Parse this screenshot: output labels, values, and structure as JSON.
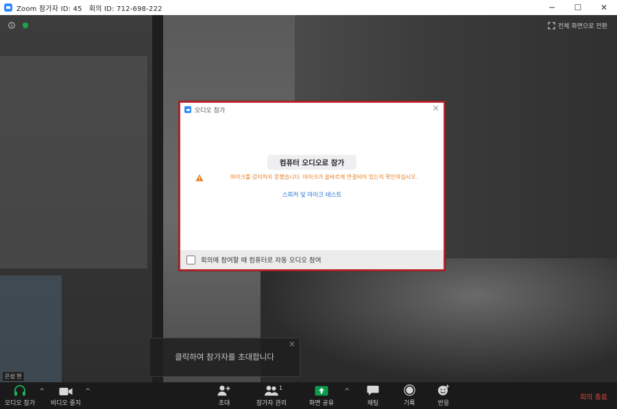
{
  "window": {
    "title": "Zoom 참가자 ID: 45   회의 ID: 712-698-222",
    "minimize_glyph": "─",
    "maximize_glyph": "☐",
    "close_glyph": "✕"
  },
  "video_overlay": {
    "fullscreen_label": "전체 화면으로 전환",
    "participant_name": "은성 한"
  },
  "dialog": {
    "title": "오디오 참가",
    "close_glyph": "×",
    "join_button_label": "컴퓨터 오디오로 참가",
    "warning_text": "마이크를 감지하지 못했습니다. 마이크가 올바르게 연결되어 있는지 확인하십시오.",
    "test_link_label": "스피커 및 마이크 테스트",
    "auto_join_label": "회의에 참여할 때 컴퓨터로 자동 오디오 참여",
    "auto_join_checked": false,
    "highlight_color": "#c0272d"
  },
  "invite_tooltip": {
    "text": "클릭하여 참가자를 초대합니다",
    "close_glyph": "×"
  },
  "toolbar": {
    "audio_label": "오디오 참가",
    "video_label": "비디오 중지",
    "invite_label": "초대",
    "participants_label": "참가자 관리",
    "participants_count": "1",
    "share_label": "화면 공유",
    "chat_label": "채팅",
    "record_label": "기록",
    "reactions_label": "반응",
    "end_label": "회의 종료",
    "caret_glyph": "^",
    "share_color": "#0e9a4a",
    "end_color": "#e0463f"
  }
}
